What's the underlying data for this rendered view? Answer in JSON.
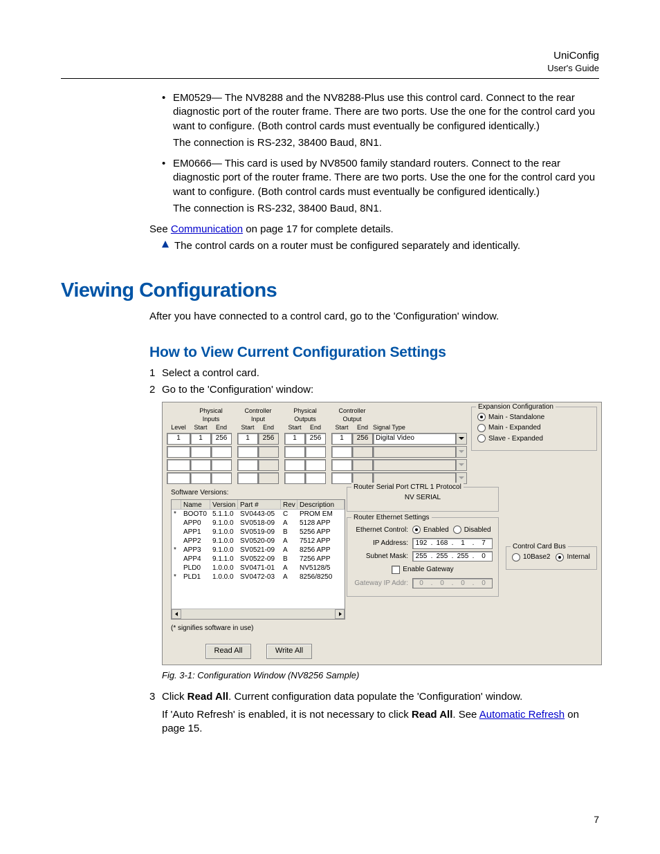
{
  "header": {
    "brand": "UniConfig",
    "guide": "User's Guide"
  },
  "bullets": [
    {
      "label": "EM0529",
      "rest": "— The NV8288 and the NV8288-Plus use this control card. Connect to the rear diagnostic port of the router frame. There are two ports. Use the one for the control card you want to configure. (Both control cards must eventually be configured identically.)",
      "conn": "The connection is RS-232, 38400 Baud, 8N1."
    },
    {
      "label": "EM0666",
      "rest": "— This card is used by NV8500 family standard routers. Connect to the rear diagnostic port of the router frame. There are two ports. Use the one for the control card you want to configure. (Both control cards must eventually be configured identically.)",
      "conn": "The connection is RS-232, 38400 Baud, 8N1."
    }
  ],
  "see": {
    "pre": "See ",
    "link": "Communication",
    "post": " on page 17 for complete details."
  },
  "note": "The control cards on a router must be configured separately and identically.",
  "h1": "Viewing Configurations",
  "intro2": "After you have connected to a control card, go to the 'Configuration' window.",
  "h2": "How to View Current Configuration Settings",
  "steps": {
    "1": "Select a control card.",
    "2": "Go to the 'Configuration' window:",
    "3a": "Click ",
    "3b_bold": "Read All",
    "3c": ". Current configuration data populate the 'Configuration' window.",
    "3d": "If 'Auto Refresh' is enabled, it is not necessary to click ",
    "3e_bold": "Read All",
    "3f": ". See ",
    "3g_link": "Automatic Refresh",
    "3h": " on page 15."
  },
  "figcap": "Fig. 3-1: Configuration Window (NV8256 Sample)",
  "pagenum": "7",
  "cfg": {
    "headers": {
      "level": "Level",
      "phys_in": "Physical\nInputs",
      "ctrl_in": "Controller\nInput",
      "phys_out": "Physical\nOutputs",
      "ctrl_out": "Controller\nOutput",
      "start": "Start",
      "end": "End",
      "sigtype": "Signal Type"
    },
    "row1": {
      "level": "1",
      "pi_s": "1",
      "pi_e": "256",
      "ci_s": "1",
      "ci_e": "256",
      "po_s": "1",
      "po_e": "256",
      "co_s": "1",
      "co_e": "256",
      "sig": "Digital Video"
    },
    "expansion": {
      "title": "Expansion Configuration",
      "o1": "Main - Standalone",
      "o2": "Main - Expanded",
      "o3": "Slave - Expanded"
    },
    "sw": {
      "title": "Software Versions:",
      "cols": {
        "name": "Name",
        "ver": "Version",
        "part": "Part #",
        "rev": "Rev",
        "desc": "Description"
      },
      "rows": [
        {
          "m": "*",
          "name": "BOOT0",
          "ver": "5.1.1.0",
          "part": "SV0443-05",
          "rev": "C",
          "desc": "PROM EM"
        },
        {
          "m": "",
          "name": "APP0",
          "ver": "9.1.0.0",
          "part": "SV0518-09",
          "rev": "A",
          "desc": "5128 APP"
        },
        {
          "m": "",
          "name": "APP1",
          "ver": "9.1.0.0",
          "part": "SV0519-09",
          "rev": "B",
          "desc": "5256 APP"
        },
        {
          "m": "",
          "name": "APP2",
          "ver": "9.1.0.0",
          "part": "SV0520-09",
          "rev": "A",
          "desc": "7512 APP"
        },
        {
          "m": "*",
          "name": "APP3",
          "ver": "9.1.0.0",
          "part": "SV0521-09",
          "rev": "A",
          "desc": "8256 APP"
        },
        {
          "m": "",
          "name": "APP4",
          "ver": "9.1.1.0",
          "part": "SV0522-09",
          "rev": "B",
          "desc": "7256 APP"
        },
        {
          "m": "",
          "name": "PLD0",
          "ver": "1.0.0.0",
          "part": "SV0471-01",
          "rev": "A",
          "desc": "NV5128/5"
        },
        {
          "m": "*",
          "name": "PLD1",
          "ver": "1.0.0.0",
          "part": "SV0472-03",
          "rev": "A",
          "desc": "8256/8250"
        }
      ],
      "note": "(* signifies software in use)"
    },
    "serial": {
      "title": "Router Serial Port CTRL 1 Protocol",
      "value": "NV SERIAL"
    },
    "eth": {
      "title": "Router Ethernet Settings",
      "ctrl_label": "Ethernet Control:",
      "enabled": "Enabled",
      "disabled": "Disabled",
      "ip_label": "IP Address:",
      "ip": [
        "192",
        "168",
        "1",
        "7"
      ],
      "mask_label": "Subnet Mask:",
      "mask": [
        "255",
        "255",
        "255",
        "0"
      ],
      "gw_chk": "Enable Gateway",
      "gw_label": "Gateway IP Addr:",
      "gw": [
        "0",
        "0",
        "0",
        "0"
      ]
    },
    "bus": {
      "title": "Control Card Bus",
      "o1": "10Base2",
      "o2": "Internal"
    },
    "btns": {
      "read": "Read All",
      "write": "Write All"
    }
  }
}
